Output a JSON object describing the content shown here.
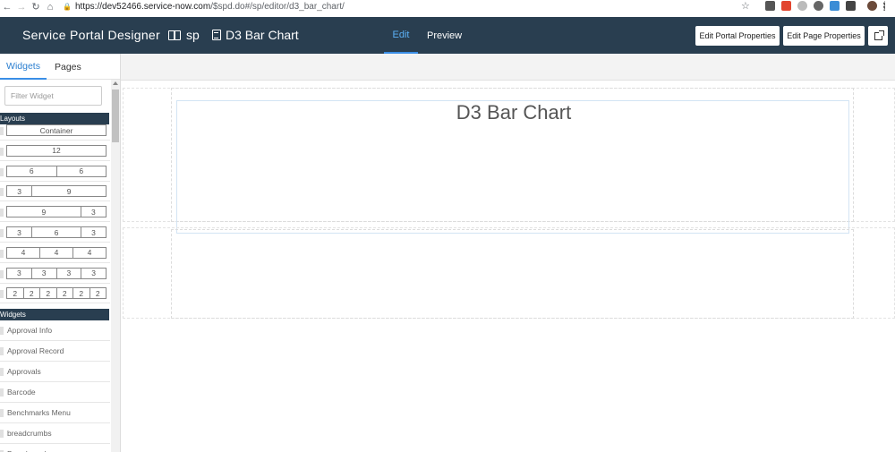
{
  "browser": {
    "url_host": "https://dev52466.service-now.com",
    "url_path": "/$spd.do#/sp/editor/d3_bar_chart/"
  },
  "header": {
    "brand": "Service Portal Designer",
    "portal": "sp",
    "page": "D3 Bar Chart",
    "tab_edit": "Edit",
    "tab_preview": "Preview",
    "btn_portal": "Edit Portal Properties",
    "btn_page": "Edit Page Properties"
  },
  "sidebar": {
    "tab_widgets": "Widgets",
    "tab_pages": "Pages",
    "filter_placeholder": "Filter Widget",
    "layouts_title": "Layouts",
    "widgets_title": "Widgets",
    "layouts": [
      [
        "Container"
      ],
      [
        "12"
      ],
      [
        "6",
        "6"
      ],
      [
        "3",
        "9"
      ],
      [
        "9",
        "3"
      ],
      [
        "3",
        "6",
        "3"
      ],
      [
        "4",
        "4",
        "4"
      ],
      [
        "3",
        "3",
        "3",
        "3"
      ],
      [
        "2",
        "2",
        "2",
        "2",
        "2",
        "2"
      ]
    ],
    "widgets": [
      "Approval Info",
      "Approval Record",
      "Approvals",
      "Barcode",
      "Benchmarks Menu",
      "breadcrumbs",
      "Breadcrumbs"
    ]
  },
  "canvas": {
    "widget_title": "D3 Bar Chart"
  }
}
